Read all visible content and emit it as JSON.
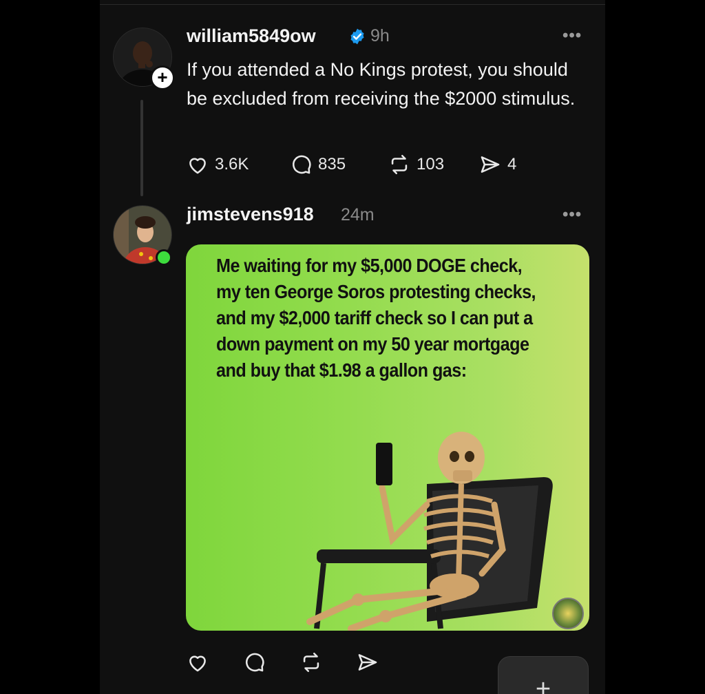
{
  "posts": [
    {
      "username": "william5849ow",
      "verified": true,
      "time": "9h",
      "text": "If you attended a No Kings protest, you should be excluded from receiving the $2000 stimulus.",
      "likes": "3.6K",
      "replies": "835",
      "reposts": "103",
      "shares": "4"
    },
    {
      "username": "jimstevens918",
      "time": "24m",
      "meme_caption": "Me waiting for my $5,000 DOGE check, my ten George Soros protesting checks, and my $2,000 tariff check so I can put a down payment on my 50 year mortgage and buy that $1.98 a gallon gas:"
    }
  ],
  "icons": {
    "more": "•••",
    "follow": "+",
    "compose": "+"
  },
  "colors": {
    "background": "#101010",
    "verified": "#1d9bf0",
    "online": "#3ddc3d"
  }
}
